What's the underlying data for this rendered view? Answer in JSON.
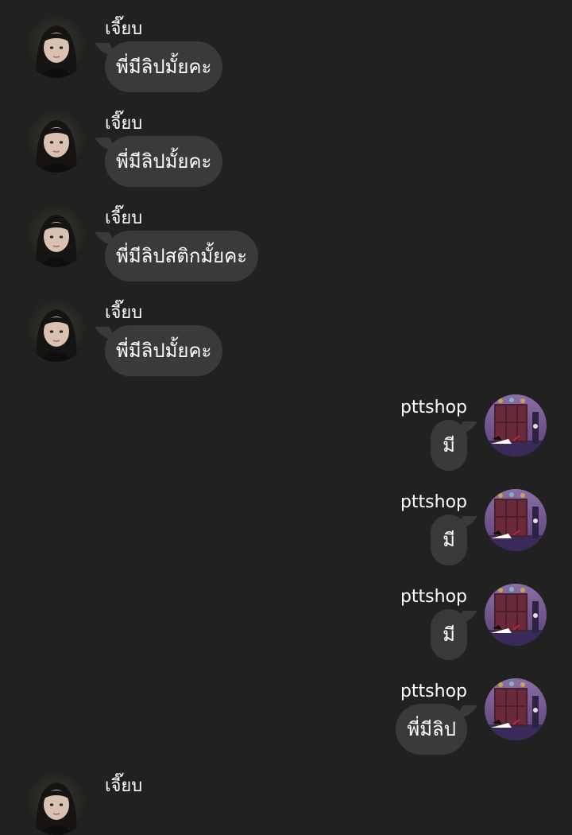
{
  "chat": {
    "messages": [
      {
        "direction": "in",
        "sender": "เจี๊ยบ",
        "text": "พี่มีลิปมั้ยคะ"
      },
      {
        "direction": "in",
        "sender": "เจี๊ยบ",
        "text": "พี่มีลิปมั้ยคะ"
      },
      {
        "direction": "in",
        "sender": "เจี๊ยบ",
        "text": "พี่มีลิปสติกมั้ยคะ"
      },
      {
        "direction": "in",
        "sender": "เจี๊ยบ",
        "text": "พี่มีลิปมั้ยคะ"
      },
      {
        "direction": "out",
        "sender": "pttshop",
        "text": "มี"
      },
      {
        "direction": "out",
        "sender": "pttshop",
        "text": "มี"
      },
      {
        "direction": "out",
        "sender": "pttshop",
        "text": "มี"
      },
      {
        "direction": "out",
        "sender": "pttshop",
        "text": "พี่มีลิป"
      },
      {
        "direction": "in",
        "sender": "เจี๊ยบ",
        "text": ""
      }
    ]
  },
  "colors": {
    "background": "#212121",
    "bubble": "#3a3a3a",
    "text": "#ffffff"
  },
  "icons": {
    "incoming_avatar": "user-photo-avatar",
    "outgoing_avatar": "shop-cartoon-avatar"
  }
}
